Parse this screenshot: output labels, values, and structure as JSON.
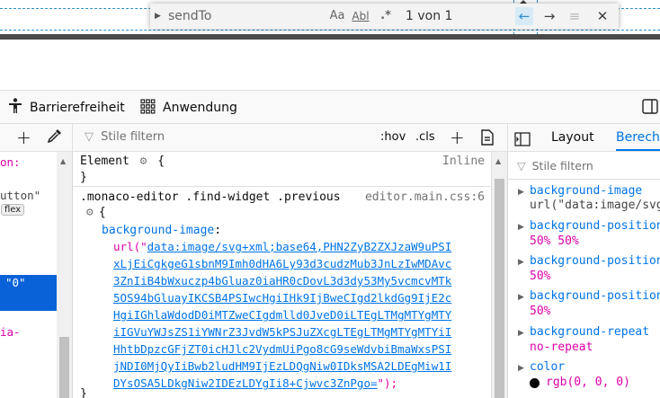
{
  "find_widget": {
    "query": "sendTo",
    "match_case_label": "Aa",
    "whole_word_label": "Abl",
    "regex_label": ".*",
    "count": "1 von 1"
  },
  "devtools_tabs": [
    {
      "label": "Barrierefreiheit",
      "icon": "accessibility-icon"
    },
    {
      "label": "Anwendung",
      "icon": "application-grid-icon"
    }
  ],
  "toolbar": {
    "filter_placeholder": "Stile filtern",
    "hov_label": ":hov",
    "cls_label": ".cls"
  },
  "markup_panel": {
    "lines": [
      "on:",
      "utton\"",
      "flex",
      "\"0\"",
      "ia-"
    ]
  },
  "rules": {
    "element_label": "Element",
    "open_brace": "{",
    "close_brace": "}",
    "inline_label": "Inline",
    "selector": ".monaco-editor .find-widget .previous",
    "source": "editor.main.css:6",
    "property": "background-image",
    "url_prefix": "url(\"",
    "url_lines": [
      "data:image/svg+xml;base64,PHN2ZyB2ZXJzaW9uPSI",
      "xLjEiCgkgeG1sbnM9Imh0dHA6Ly93d3cudzMub3JnLzIwMDAvc",
      "3ZnIiB4bWxuczp4bGluaz0iaHR0cDovL3d3dy53My5vcmcvMTk",
      "5OS94bGluayIKCSB4PSIwcHgiIHk9IjBweCIgd2lkdGg9IjE2c",
      "HgiIGhlaWdodD0iMTZweCIgdmlld0JveD0iLTEgLTMgMTYgMTY",
      "iIGVuYWJsZS1iYWNrZ3JvdW5kPSJuZXcgLTEgLTMgMTYgMTYiI",
      "HhtbDpzcGFjZT0icHJlc2VydmUiPgo8cG9seWdvbiBmaWxsPSI",
      "jNDI0MjQyIiBwb2ludHM9IjEzLDQgNiw0IDksMSA2LDEgMiw1I",
      "DYsOSA5LDkgNiw2IDEzLDYgIi8+Cjwvc3ZnPgo="
    ],
    "url_suffix": "\");"
  },
  "computed": {
    "tabs": [
      "Layout",
      "Berechn"
    ],
    "filter_placeholder": "Stile filtern",
    "props": [
      {
        "name": "background-image",
        "value": "url(\"data:image/svg"
      },
      {
        "name": "background-position",
        "value": "50% 50%"
      },
      {
        "name": "background-position",
        "value": "50%"
      },
      {
        "name": "background-position",
        "value": "50%"
      },
      {
        "name": "background-repeat",
        "value": "no-repeat"
      },
      {
        "name": "color",
        "value": "rgb(0, 0, 0)"
      }
    ]
  },
  "colors": {
    "accent": "#0074e8",
    "property_value": "#dd00a9",
    "selected_row": "#0a62d8"
  }
}
